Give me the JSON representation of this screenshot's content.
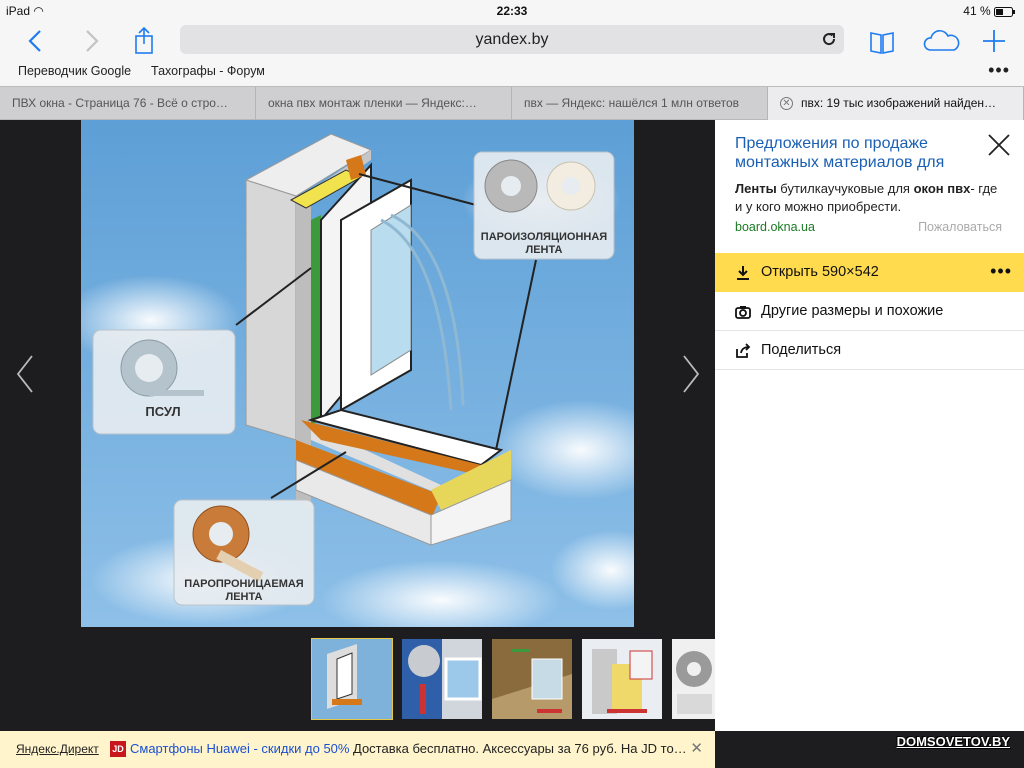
{
  "status": {
    "device": "iPad",
    "time": "22:33",
    "battery": "41 %"
  },
  "browser": {
    "url": "yandex.by",
    "bookmarks": [
      "Переводчик Google",
      "Тахографы - Форум"
    ],
    "tabs": [
      "ПВХ окна - Страница 76 - Всё о стро…",
      "окна пвх монтаж пленки — Яндекс:…",
      "пвх — Яндекс: нашёлся 1 млн ответов",
      "пвх: 19 тыс изображений найден…"
    ]
  },
  "image": {
    "labels": {
      "vapor_barrier": [
        "ПАРОИЗОЛЯЦИОННАЯ",
        "ЛЕНТА"
      ],
      "psul": "ПСУЛ",
      "vapor_permeable": [
        "ПАРОПРОНИЦАЕМАЯ",
        "ЛЕНТА"
      ]
    }
  },
  "sidebar": {
    "ad_title": "Предложения по продаже монтажных материалов для",
    "ad_text_parts": [
      "Ленты",
      " бутилкаучуковые для ",
      "окон пвх",
      "- где и у кого можно приобрести."
    ],
    "ad_domain": "board.okna.ua",
    "report": "Пожаловаться",
    "open_label": "Открыть 590×542",
    "similar_label": "Другие размеры и похожие",
    "share_label": "Поделиться"
  },
  "bottom": {
    "direct": "Яндекс.Директ",
    "jd": "JD",
    "ad_link": "Смартфоны Huawei - скидки до 50%",
    "ad_text": "Доставка бесплатно. Аксессуары за 76 руб. На JD то…"
  },
  "watermark": "DOMSOVETOV.BY",
  "colors": {
    "accent": "#1f7cf0",
    "yandex_yellow": "#ffdb4d",
    "link_green": "#1b7a23",
    "ad_blue": "#1a5fb4"
  }
}
